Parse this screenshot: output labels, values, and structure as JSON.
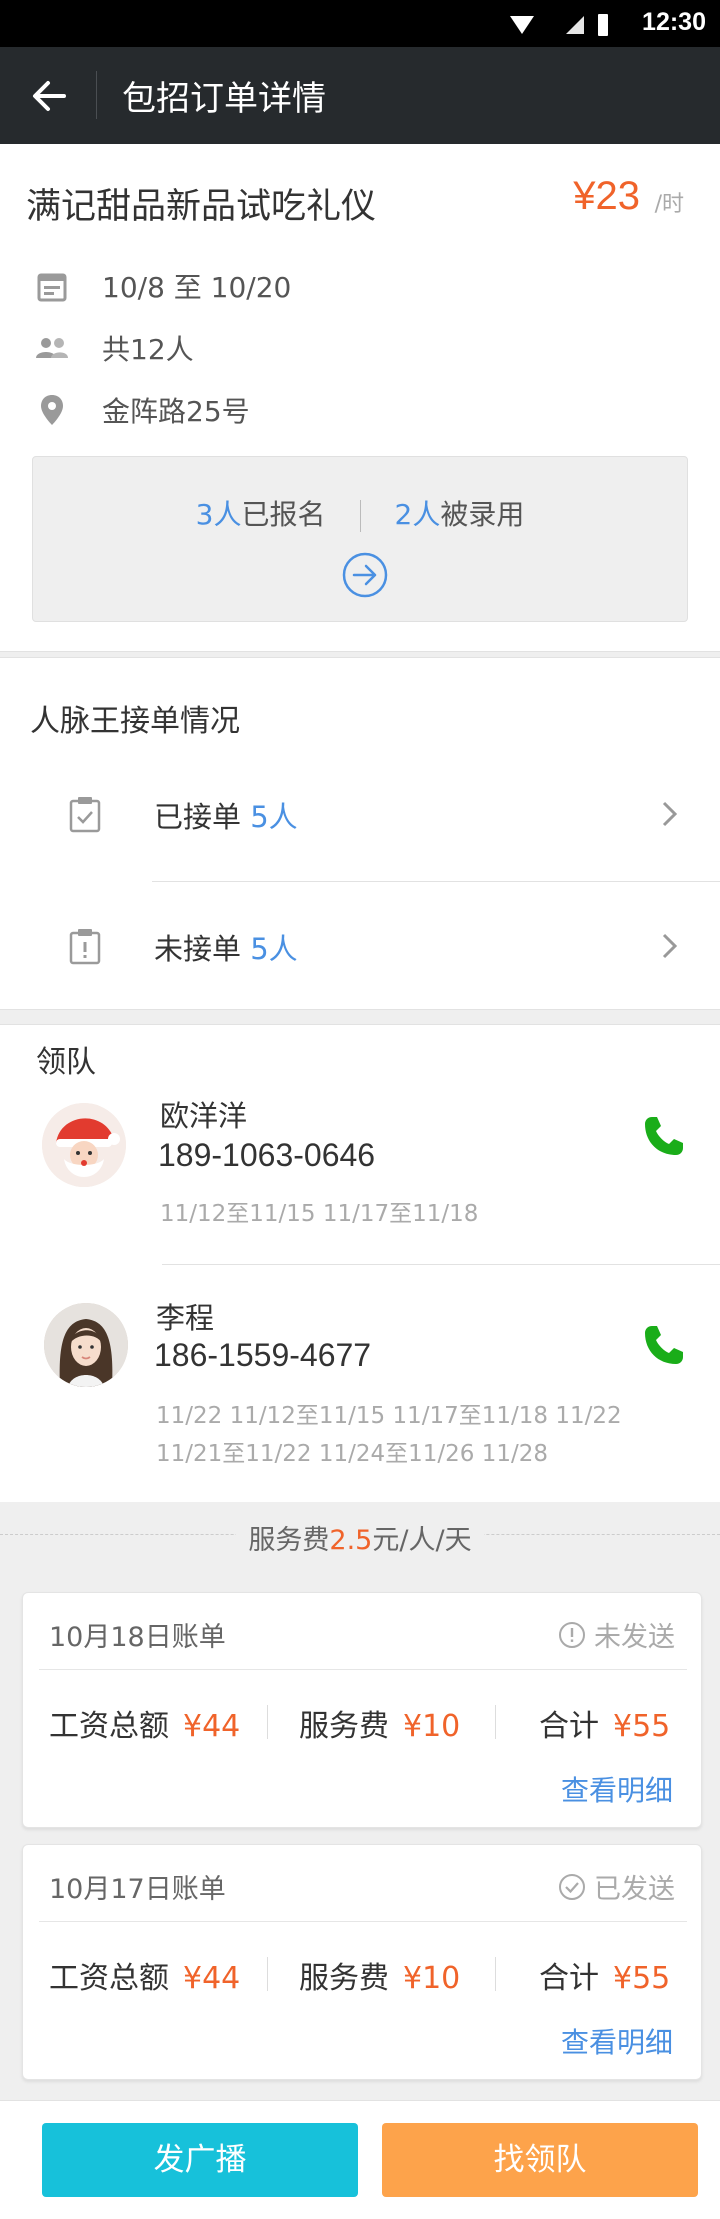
{
  "status_bar": {
    "time": "12:30"
  },
  "app_bar": {
    "title": "包招订单详情"
  },
  "job": {
    "name": "满记甜品新品试吃礼仪",
    "price": "¥23",
    "price_unit": "/时",
    "date_range": "10/8 至 10/20",
    "headcount": "共12人",
    "address": "金阵路25号",
    "signed_up_count": "3人",
    "signed_up_label": "已报名",
    "hired_count": "2人",
    "hired_label": "被录用"
  },
  "supplier": {
    "title": "人脉王接单情况",
    "rows": [
      {
        "label": "已接单",
        "count": "5人"
      },
      {
        "label": "未接单",
        "count": "5人"
      }
    ]
  },
  "leaders": {
    "title": "领队",
    "items": [
      {
        "name": "欧洋洋",
        "phone": "189-1063-0646",
        "dates_line1": "11/12至11/15   11/17至11/18",
        "dates_line2": ""
      },
      {
        "name": "李程",
        "phone": "186-1559-4677",
        "dates_line1": "11/22   11/12至11/15  11/17至11/18   11/22",
        "dates_line2": "11/21至11/22   11/24至11/26   11/28"
      }
    ]
  },
  "fee": {
    "prefix": "服务费",
    "amount": "2.5",
    "suffix": "元/人/天"
  },
  "bills": [
    {
      "date": "10月18日账单",
      "status": "未发送",
      "wage_label": "工资总额",
      "wage": "¥44",
      "fee_label": "服务费",
      "fee": "¥10",
      "total_label": "合计",
      "total": "¥55",
      "detail": "查看明细"
    },
    {
      "date": "10月17日账单",
      "status": "已发送",
      "wage_label": "工资总额",
      "wage": "¥44",
      "fee_label": "服务费",
      "fee": "¥10",
      "total_label": "合计",
      "total": "¥55",
      "detail": "查看明细"
    }
  ],
  "bottom": {
    "broadcast_label": "发广播",
    "find_leader_label": "找领队"
  },
  "colors": {
    "accent_orange": "#f0632a",
    "link_blue": "#4a90e2",
    "call_green": "#1aad19",
    "btn_cyan": "#17c1da",
    "btn_orange": "#fda34b"
  }
}
